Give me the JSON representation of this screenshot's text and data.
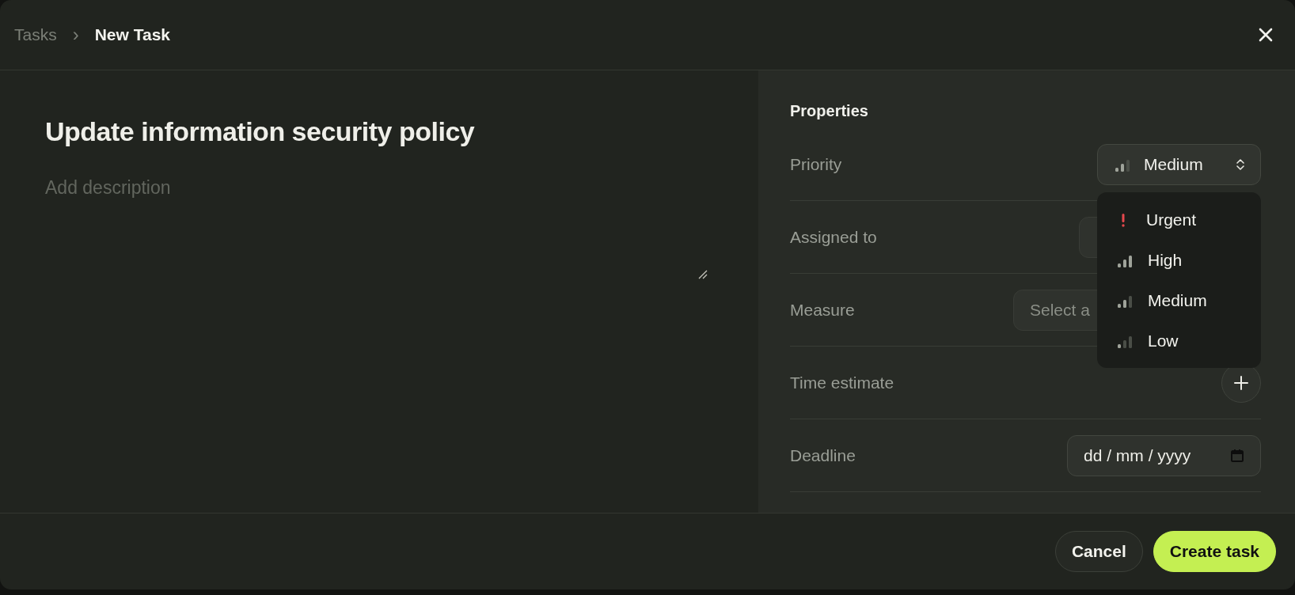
{
  "breadcrumb": {
    "parent": "Tasks",
    "separator": "›",
    "current": "New Task"
  },
  "task": {
    "title": "Update information security policy",
    "description_placeholder": "Add description"
  },
  "properties": {
    "heading": "Properties",
    "rows": [
      {
        "label": "Priority",
        "kind": "select",
        "value": {
          "label": "Medium",
          "kind": "medium"
        }
      },
      {
        "label": "Assigned to",
        "kind": "field"
      },
      {
        "label": "Measure",
        "kind": "field",
        "placeholder": "Select a"
      },
      {
        "label": "Time estimate",
        "kind": "add"
      },
      {
        "label": "Deadline",
        "kind": "date",
        "placeholder": "dd / mm / yyyy"
      }
    ]
  },
  "priority_menu": {
    "open": true,
    "items": [
      {
        "label": "Urgent",
        "kind": "urgent"
      },
      {
        "label": "High",
        "kind": "high"
      },
      {
        "label": "Medium",
        "kind": "medium"
      },
      {
        "label": "Low",
        "kind": "low"
      }
    ]
  },
  "buttons": [
    {
      "label": "Cancel",
      "kind": "secondary"
    },
    {
      "label": "Create task",
      "kind": "primary"
    }
  ]
}
